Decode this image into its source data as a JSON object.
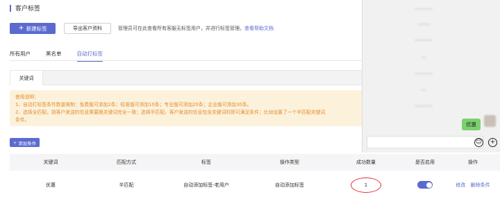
{
  "page": {
    "title": "客户标签"
  },
  "toolbar": {
    "new_tag": "新建标签",
    "export": "导出客户资料",
    "note": "管理员可在此查看所有客服无标签用户，并进行标签管理。",
    "help_link": "查看帮助文档"
  },
  "tabs": [
    "所有用户",
    "黑名单",
    "自动打标签"
  ],
  "subtab": {
    "label": "关键词"
  },
  "notice": {
    "title": "使用说明：",
    "line1": "1、自动打标签条件数量限制：免费版可添加2条；标准版可添加10条；专业版可添加20条；企业版可添加30条。",
    "line2": "2、选择全匹配，则客户发送的信息需要跟关键词完全一致；选择半匹配，客户发送的信息包含关键词时即可满足条件；比如设置了一个半匹配关键词",
    "line3": "条件。"
  },
  "add_condition": "添加条件",
  "table": {
    "headers": [
      "关键词",
      "匹配方式",
      "标签",
      "操作类型",
      "成功数量",
      "是否启用",
      "操作"
    ],
    "rows": [
      {
        "keyword": "优惠",
        "match": "半匹配",
        "tag": "自动添加标签-老用户",
        "action": "自动添加标签",
        "success_count": "1",
        "enabled": true,
        "edit": "修改",
        "delete": "删除条件"
      }
    ]
  },
  "chat": {
    "message": "优惠",
    "emoji_icon": "smiley-icon",
    "add_icon": "plus-circle-icon"
  },
  "colors": {
    "accent": "#5a6acf",
    "notice_bg": "#fcf2dc",
    "notice_text": "#e38b2a",
    "bubble": "#7bd16f",
    "highlight": "#e0322e"
  }
}
